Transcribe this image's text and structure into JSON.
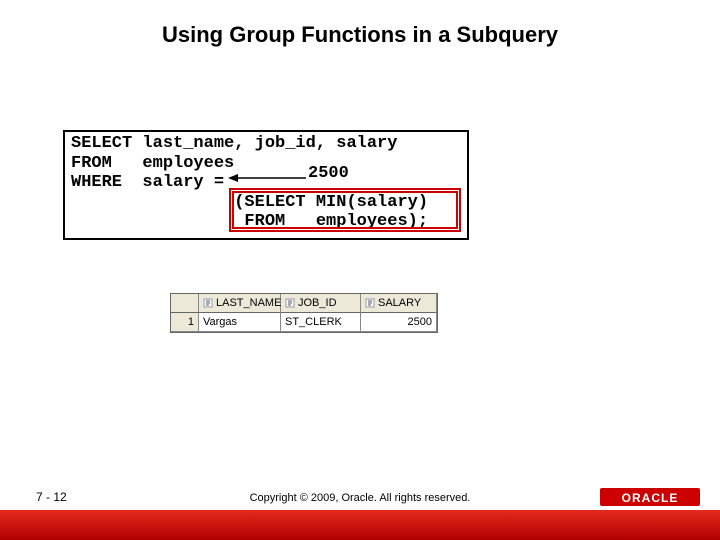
{
  "title": "Using Group Functions in a Subquery",
  "code": {
    "line1": "SELECT last_name, job_id, salary",
    "line2": "FROM   employees",
    "line3": "WHERE  salary =",
    "line4": "                (SELECT MIN(salary)",
    "line5": "                 FROM   employees);"
  },
  "annotation": "2500",
  "grid": {
    "headers": {
      "rownum": "",
      "last": "LAST_NAME",
      "job": "JOB_ID",
      "sal": "SALARY"
    },
    "row": {
      "n": "1",
      "last": "Vargas",
      "job": "ST_CLERK",
      "sal": "2500"
    }
  },
  "footer": {
    "page": "7 - 12",
    "copyright": "Copyright © 2009, Oracle. All rights reserved.",
    "logo_text": "ORACLE"
  }
}
